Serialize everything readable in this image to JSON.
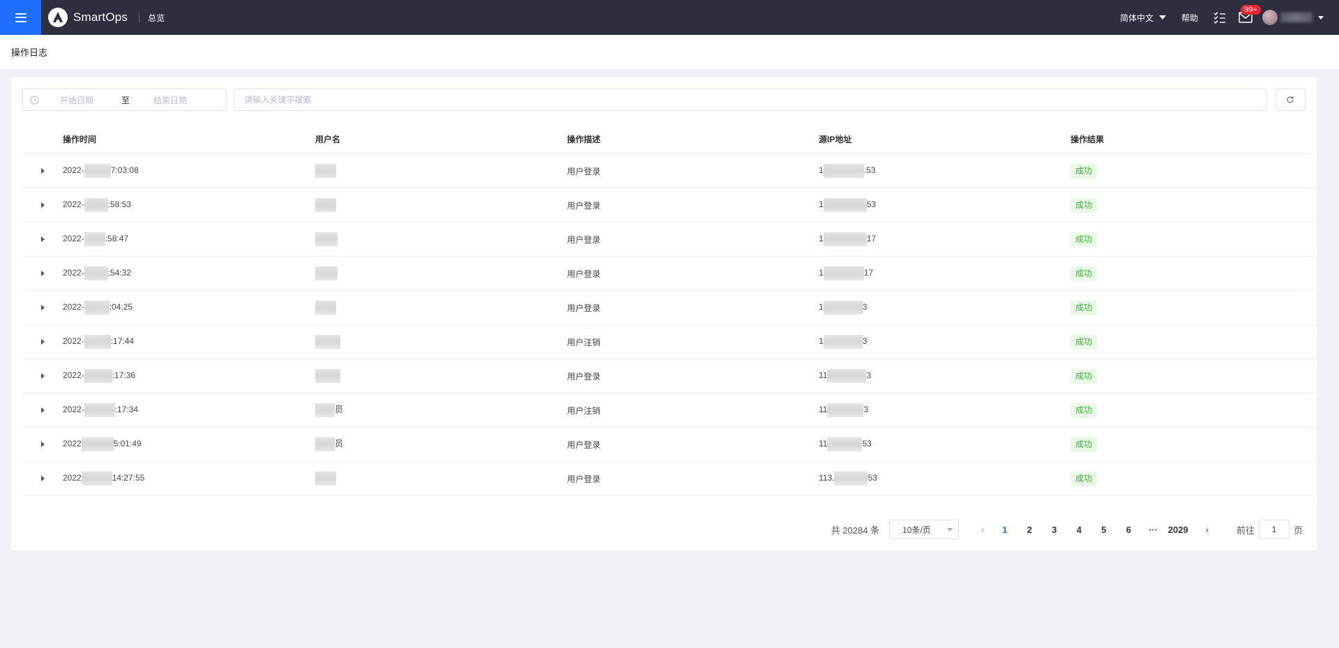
{
  "header": {
    "app_name": "SmartOps",
    "nav_overview": "总览",
    "language": "简体中文",
    "help": "帮助",
    "mail_badge": "99+",
    "icons": [
      "menu-icon",
      "logo-icon",
      "tasks-icon",
      "mail-icon",
      "avatar",
      "chevron-down-icon"
    ],
    "colors": {
      "topbar": "#2b2f3e",
      "menu_button": "#1f6fff",
      "badge": "#f5222d"
    }
  },
  "page": {
    "title": "操作日志"
  },
  "filters": {
    "date_start_placeholder": "开始日期",
    "date_separator": "至",
    "date_end_placeholder": "结束日期",
    "search_placeholder": "请输入关键字搜索"
  },
  "table": {
    "columns": [
      "操作时间",
      "用户名",
      "操作描述",
      "源IP地址",
      "操作结果"
    ],
    "rows": [
      {
        "time_prefix": "2022-",
        "time_suffix": "7:03:08",
        "user_prefix": "",
        "user_suffix": "",
        "desc": "用户登录",
        "ip_prefix": "1",
        "ip_suffix": ".53",
        "result": "成功"
      },
      {
        "time_prefix": "2022-",
        "time_suffix": ":58:53",
        "user_prefix": "",
        "user_suffix": "",
        "desc": "用户登录",
        "ip_prefix": "1",
        "ip_suffix": "53",
        "result": "成功"
      },
      {
        "time_prefix": "2022-",
        "time_suffix": ":58:47",
        "user_prefix": "",
        "user_suffix": "",
        "desc": "用户登录",
        "ip_prefix": "1",
        "ip_suffix": "17",
        "result": "成功"
      },
      {
        "time_prefix": "2022-",
        "time_suffix": ":54:32",
        "user_prefix": "",
        "user_suffix": "",
        "desc": "用户登录",
        "ip_prefix": "1",
        "ip_suffix": "17",
        "result": "成功"
      },
      {
        "time_prefix": "2022-",
        "time_suffix": ":04:25",
        "user_prefix": "",
        "user_suffix": "",
        "desc": "用户登录",
        "ip_prefix": "1",
        "ip_suffix": "3",
        "result": "成功"
      },
      {
        "time_prefix": "2022-",
        "time_suffix": ":17:44",
        "user_prefix": "",
        "user_suffix": "",
        "desc": "用户注销",
        "ip_prefix": "1",
        "ip_suffix": "3",
        "result": "成功"
      },
      {
        "time_prefix": "2022-",
        "time_suffix": ":17:36",
        "user_prefix": "",
        "user_suffix": "",
        "desc": "用户登录",
        "ip_prefix": "11",
        "ip_suffix": "3",
        "result": "成功"
      },
      {
        "time_prefix": "2022-",
        "time_suffix": ":17:34",
        "user_prefix": "",
        "user_suffix": "员",
        "desc": "用户注销",
        "ip_prefix": "11",
        "ip_suffix": "3",
        "result": "成功"
      },
      {
        "time_prefix": "2022",
        "time_suffix": "5:01:49",
        "user_prefix": "",
        "user_suffix": "员",
        "desc": "用户登录",
        "ip_prefix": "11",
        "ip_suffix": "53",
        "result": "成功"
      },
      {
        "time_prefix": "2022",
        "time_suffix": "14:27:55",
        "user_prefix": "",
        "user_suffix": "",
        "desc": "用户登录",
        "ip_prefix": "113.",
        "ip_suffix": "53",
        "result": "成功"
      }
    ]
  },
  "pagination": {
    "total": "共 20284 条",
    "page_size": "10条/页",
    "pages": [
      "1",
      "2",
      "3",
      "4",
      "5",
      "6"
    ],
    "ellipsis": "···",
    "last_page": "2029",
    "current_page": 1,
    "goto_label": "前往",
    "goto_value": "1",
    "page_suffix": "页"
  }
}
